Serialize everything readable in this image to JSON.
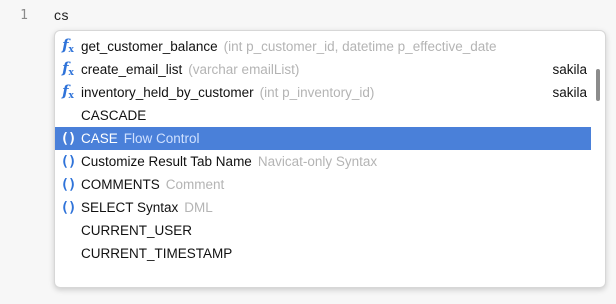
{
  "editor": {
    "line_number": "1",
    "text": "cs"
  },
  "autocomplete": {
    "items": [
      {
        "icon": "function-icon",
        "label": "get_customer_balance",
        "detail": "(int p_customer_id, datetime p_effective_date",
        "source": ""
      },
      {
        "icon": "function-icon",
        "label": "create_email_list",
        "detail": "(varchar emailList)",
        "source": "sakila"
      },
      {
        "icon": "function-icon",
        "label": "inventory_held_by_customer",
        "detail": "(int p_inventory_id)",
        "source": "sakila"
      },
      {
        "icon": "",
        "label": "CASCADE",
        "detail": "",
        "source": ""
      },
      {
        "icon": "snippet-icon",
        "label": "CASE",
        "detail": "Flow Control",
        "source": "",
        "selected": true
      },
      {
        "icon": "snippet-icon",
        "label": "Customize Result Tab Name",
        "detail": "Navicat-only Syntax",
        "source": ""
      },
      {
        "icon": "snippet-icon",
        "label": "COMMENTS",
        "detail": "Comment",
        "source": ""
      },
      {
        "icon": "snippet-icon",
        "label": "SELECT Syntax",
        "detail": "DML",
        "source": ""
      },
      {
        "icon": "",
        "label": "CURRENT_USER",
        "detail": "",
        "source": ""
      },
      {
        "icon": "",
        "label": "CURRENT_TIMESTAMP",
        "detail": "",
        "source": ""
      }
    ]
  },
  "colors": {
    "selection": "#4a80d9",
    "icon": "#2f73d9",
    "detail_text": "#b4b4b4",
    "match_highlight": "#fff2a8"
  }
}
